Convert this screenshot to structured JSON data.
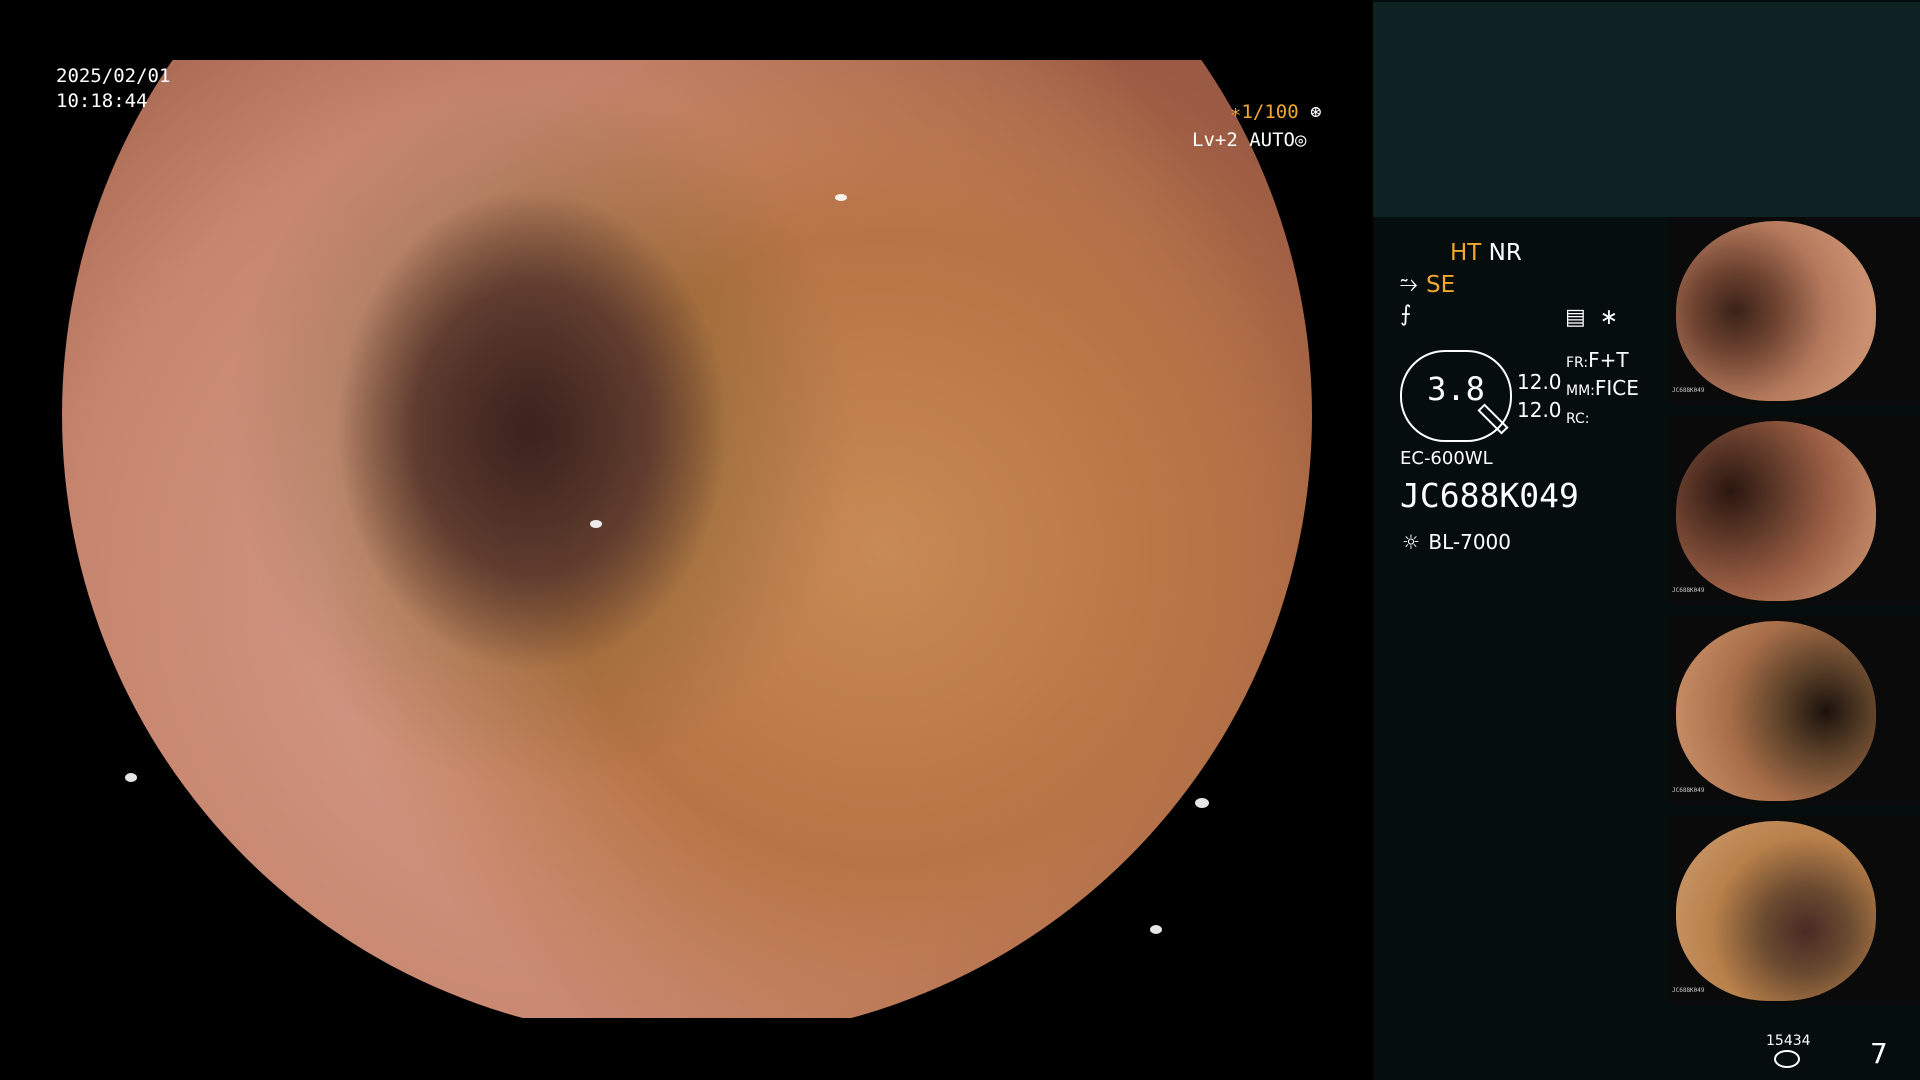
{
  "overlay": {
    "date": "2025/02/01",
    "time": "10:18:44",
    "shutter": "∗1/100",
    "level": "Lv+2 AUTO"
  },
  "panel": {
    "ht": "HT",
    "nr": "NR",
    "se": "SE",
    "zoom_value": "3.8",
    "num1": "12.0",
    "num2": "12.0",
    "fr_label": "FR:",
    "fr_value": "F+T",
    "mm_label": "MM:",
    "mm_value": "FICE",
    "rc_label": "RC:",
    "scope_model": "EC-600WL",
    "scope_serial": "JC688K049",
    "light_source": "BL-7000",
    "counter": "15434",
    "page": "7"
  },
  "thumbnails": [
    {
      "id": "JC688K049",
      "tone": "#b57a5d"
    },
    {
      "id": "JC688K049",
      "tone": "#9b5e44"
    },
    {
      "id": "JC688K049",
      "tone": "#a66d48"
    },
    {
      "id": "JC688K049",
      "tone": "#b8804a"
    }
  ]
}
